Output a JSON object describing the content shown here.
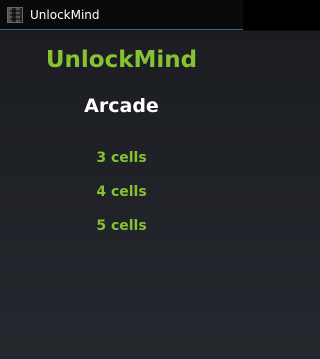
{
  "window": {
    "title": "UnlockMind",
    "icon": "app-icon"
  },
  "main": {
    "heading": "UnlockMind",
    "subheading": "Arcade",
    "options": [
      {
        "label": "3 cells"
      },
      {
        "label": "4 cells"
      },
      {
        "label": "5 cells"
      }
    ]
  },
  "colors": {
    "accent": "#86c232",
    "title_bar_line": "#3a6f8e",
    "text": "#ffffff"
  }
}
